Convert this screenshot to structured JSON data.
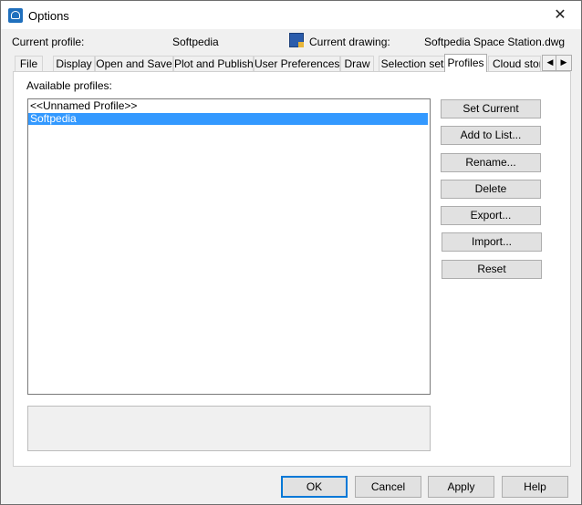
{
  "window": {
    "title": "Options",
    "close_glyph": "✕"
  },
  "header": {
    "current_profile_label": "Current profile:",
    "current_profile_value": "Softpedia",
    "current_drawing_label": "Current drawing:",
    "current_drawing_value": "Softpedia Space Station.dwg",
    "drawing_icon": "dwg-file-icon"
  },
  "tabs": [
    {
      "label": "File"
    },
    {
      "label": "Display"
    },
    {
      "label": "Open and Save"
    },
    {
      "label": "Plot and Publish"
    },
    {
      "label": "User Preferences"
    },
    {
      "label": "Draw"
    },
    {
      "label": "Selection set"
    },
    {
      "label": "Profiles"
    },
    {
      "label": "Cloud stora"
    }
  ],
  "active_tab": "Profiles",
  "tab_scroll": {
    "left": "◀",
    "right": "▶"
  },
  "profiles": {
    "label": "Available profiles:",
    "items": [
      {
        "label": "<<Unnamed Profile>>",
        "selected": false
      },
      {
        "label": "Softpedia",
        "selected": true
      }
    ]
  },
  "side_buttons": {
    "set_current": "Set Current",
    "add_to_list": "Add to List...",
    "rename": "Rename...",
    "delete": "Delete",
    "export": "Export...",
    "import": "Import...",
    "reset": "Reset"
  },
  "bottom_buttons": {
    "ok": "OK",
    "cancel": "Cancel",
    "apply": "Apply",
    "help": "Help"
  },
  "colors": {
    "selection": "#3399ff",
    "default_button_border": "#0078d7"
  }
}
